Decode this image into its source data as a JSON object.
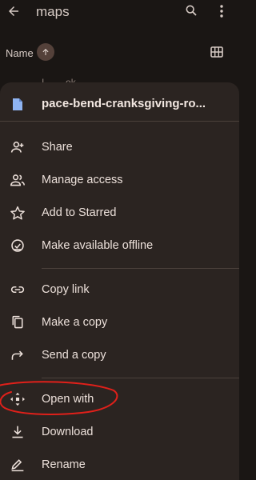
{
  "appbar": {
    "title": "maps",
    "icons": [
      "back-arrow-icon",
      "search-icon",
      "more-vert-icon"
    ]
  },
  "sortbar": {
    "label": "Name",
    "icons": [
      "arrow-up-icon",
      "grid-view-icon"
    ]
  },
  "behind": {
    "partial_text": "I ___ ok"
  },
  "sheet": {
    "file_name": "pace-bend-cranksgiving-ro...",
    "items": [
      {
        "label": "Share",
        "icon": "person-add-icon"
      },
      {
        "label": "Manage access",
        "icon": "people-icon"
      },
      {
        "label": "Add to Starred",
        "icon": "star-outline-icon"
      },
      {
        "label": "Make available offline",
        "icon": "offline-check-icon"
      },
      {
        "label": "Copy link",
        "icon": "link-icon"
      },
      {
        "label": "Make a copy",
        "icon": "copy-icon"
      },
      {
        "label": "Send a copy",
        "icon": "forward-icon"
      },
      {
        "label": "Open with",
        "icon": "move-arrows-icon"
      },
      {
        "label": "Download",
        "icon": "download-icon"
      },
      {
        "label": "Rename",
        "icon": "edit-icon"
      }
    ]
  },
  "colors": {
    "background": "#1a1614",
    "sheet": "#2b2421",
    "text": "#ece0da",
    "file_icon": "#8fb4f2",
    "annotation": "#e0201a"
  }
}
